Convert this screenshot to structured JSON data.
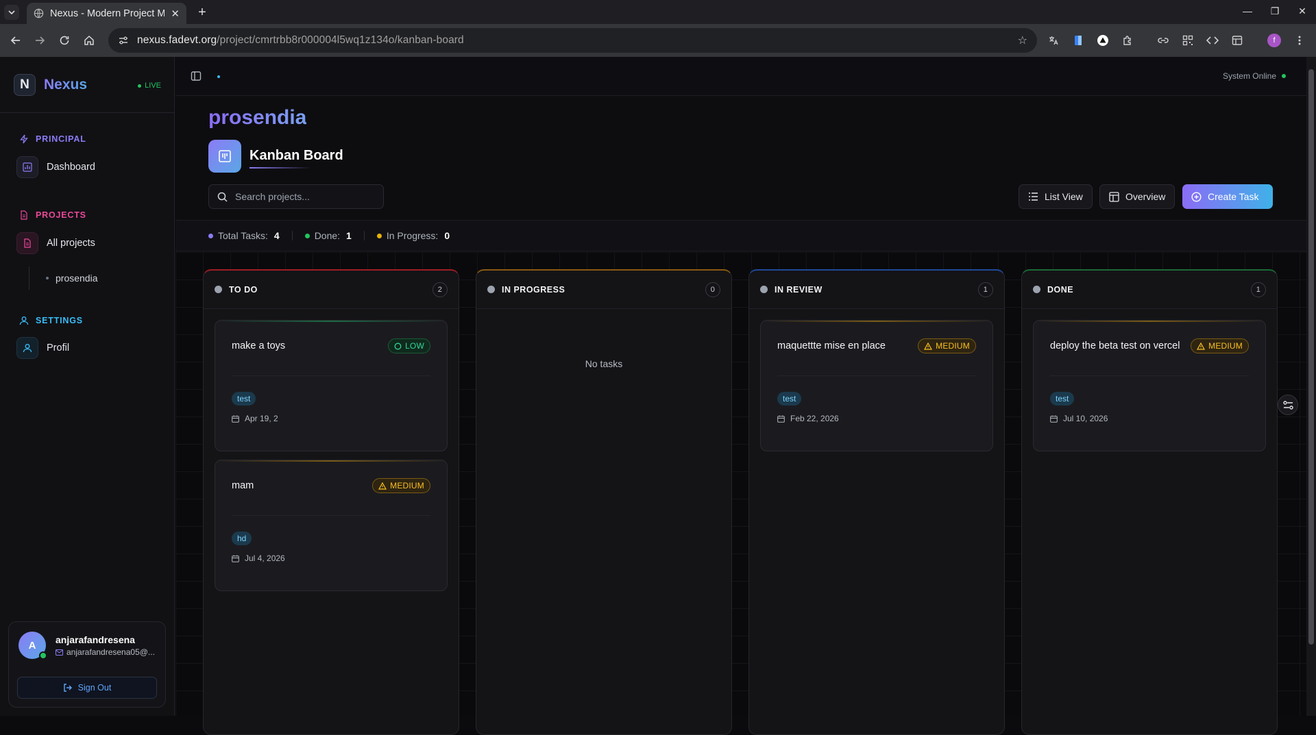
{
  "browser": {
    "tab_title": "Nexus - Modern Project Ma",
    "url_domain": "nexus.fadevt.org",
    "url_path": "/project/cmrtrbb8r000004l5wq1z134o/kanban-board",
    "profile_initial": "f"
  },
  "sidebar": {
    "brand": "Nexus",
    "live": "LIVE",
    "sections": {
      "principal": "PRINCIPAL",
      "projects": "PROJECTS",
      "settings": "SETTINGS"
    },
    "items": {
      "dashboard": "Dashboard",
      "all_projects": "All projects",
      "sub_project": "prosendia",
      "profil": "Profil"
    },
    "user": {
      "initial": "A",
      "name": "anjarafandresena",
      "email": "anjarafandresena05@..."
    },
    "sign_out": "Sign Out"
  },
  "topbar": {
    "system_status": "System Online"
  },
  "header": {
    "project_name": "prosendia",
    "board_title": "Kanban Board",
    "search_placeholder": "Search projects...",
    "list_view": "List View",
    "overview": "Overview",
    "create_task": "Create Task"
  },
  "stats": {
    "total_label": "Total Tasks:",
    "total_value": "4",
    "done_label": "Done:",
    "done_value": "1",
    "progress_label": "In Progress:",
    "progress_value": "0"
  },
  "columns": [
    {
      "title": "TO DO",
      "count": "2",
      "accent": "#b91c1c",
      "cards": [
        {
          "title": "make a toys",
          "priority": "LOW",
          "tag": "test",
          "date": "Apr 19, 2"
        },
        {
          "title": "mam",
          "priority": "MEDIUM",
          "tag": "hd",
          "date": "Jul 4, 2026"
        }
      ]
    },
    {
      "title": "IN PROGRESS",
      "count": "0",
      "accent": "#a16207",
      "empty_text": "No tasks",
      "cards": []
    },
    {
      "title": "IN REVIEW",
      "count": "1",
      "accent": "#1d4ed8",
      "cards": [
        {
          "title": "maquettte mise en place",
          "priority": "MEDIUM",
          "tag": "test",
          "date": "Feb 22, 2026"
        }
      ]
    },
    {
      "title": "DONE",
      "count": "1",
      "accent": "#15803d",
      "cards": [
        {
          "title": "deploy the beta test on vercel",
          "priority": "MEDIUM",
          "tag": "test",
          "date": "Jul 10, 2026"
        }
      ]
    }
  ],
  "colors": {
    "accent_purple": "#8b7cf6",
    "accent_cyan": "#3fb2e8",
    "online_green": "#22c55e",
    "medium_amber": "#fbbf24",
    "low_green": "#34d399"
  }
}
